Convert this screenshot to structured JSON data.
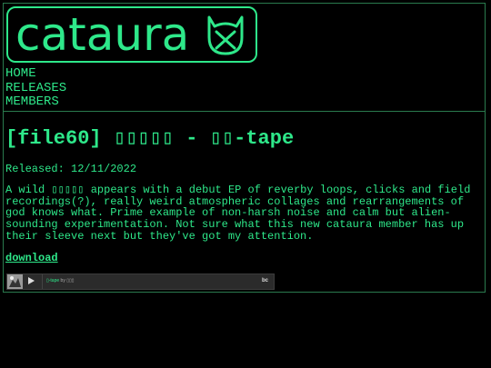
{
  "site": {
    "logo_text": "cataura"
  },
  "nav": {
    "items": [
      "HOME",
      "RELEASES",
      "MEMBERS"
    ]
  },
  "release": {
    "title": "[file60] ▯▯▯▯▯ - ▯▯-tape",
    "released": "Released: 12/11/2022",
    "description": "A wild ▯▯▯▯▯ appears with a debut EP of reverby loops, clicks and field recordings(?), really weird atmospheric collages and rearrangements of god knows what. Prime example of non-harsh noise and calm but alien-sounding experimentation. Not sure what this new cataura member has up their sleeve next but they've got my attention.",
    "download_label": "download"
  },
  "player": {
    "track_title": "▯-tape",
    "by_text": "by ▯▯▯",
    "brand": "bc"
  },
  "colors": {
    "accent": "#2ee88a",
    "background": "#000000",
    "border": "#2a7a4e"
  }
}
